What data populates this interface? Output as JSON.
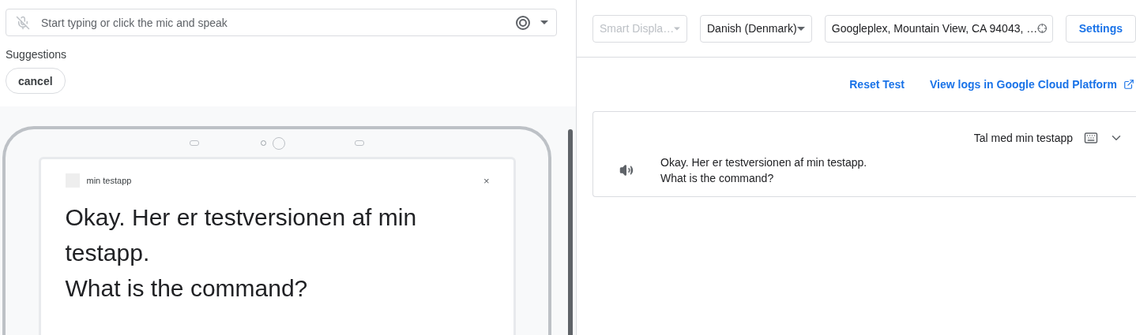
{
  "input": {
    "placeholder": "Start typing or click the mic and speak"
  },
  "suggestions": {
    "label": "Suggestions",
    "chips": [
      "cancel"
    ]
  },
  "device_card": {
    "app_name": "min testapp",
    "close": "×",
    "lines": [
      "Okay. Her er testversionen af min testapp.",
      "What is the command?"
    ]
  },
  "toolbar": {
    "selects": [
      {
        "value": "Smart Displa…",
        "disabled": true
      },
      {
        "value": "Danish (Denmark)",
        "disabled": false
      }
    ],
    "location": "Googleplex, Mountain View, CA 94043, …",
    "settings": "Settings"
  },
  "links": [
    "Reset Test",
    "View logs in Google Cloud Platform"
  ],
  "conversation": {
    "user": "Tal med min testapp",
    "response": [
      "Okay. Her er testversionen af min testapp.",
      "What is the command?"
    ]
  }
}
